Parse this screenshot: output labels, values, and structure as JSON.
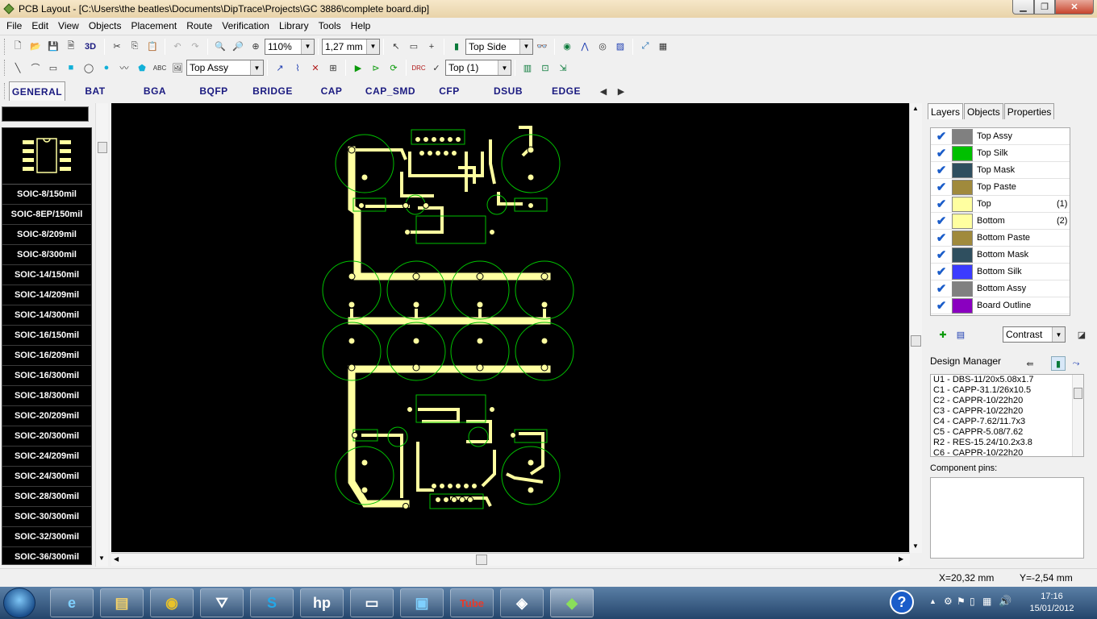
{
  "window": {
    "title": "PCB Layout - [C:\\Users\\the beatles\\Documents\\DipTrace\\Projects\\GC 3886\\complete board.dip]"
  },
  "menu": [
    "File",
    "Edit",
    "View",
    "Objects",
    "Placement",
    "Route",
    "Verification",
    "Library",
    "Tools",
    "Help"
  ],
  "toolbar": {
    "zoom_value": "110%",
    "grid_value": "1,27 mm",
    "side_value": "Top Side",
    "view_3d_label": "3D",
    "display_mode_value": "Top Assy",
    "layer_value": "Top (1)"
  },
  "library_tabs": [
    "GENERAL",
    "BAT",
    "BGA",
    "BQFP",
    "BRIDGE",
    "CAP",
    "CAP_SMD",
    "CFP",
    "DSUB",
    "EDGE"
  ],
  "library_items": [
    "SOIC-8/150mil",
    "SOIC-8EP/150mil",
    "SOIC-8/209mil",
    "SOIC-8/300mil",
    "SOIC-14/150mil",
    "SOIC-14/209mil",
    "SOIC-14/300mil",
    "SOIC-16/150mil",
    "SOIC-16/209mil",
    "SOIC-16/300mil",
    "SOIC-18/300mil",
    "SOIC-20/209mil",
    "SOIC-20/300mil",
    "SOIC-24/209mil",
    "SOIC-24/300mil",
    "SOIC-28/300mil",
    "SOIC-30/300mil",
    "SOIC-32/300mil",
    "SOIC-36/300mil"
  ],
  "right_tabs": [
    "Layers",
    "Objects",
    "Properties"
  ],
  "layers": [
    {
      "name": "Top Assy",
      "color": "#808080",
      "num": ""
    },
    {
      "name": "Top Silk",
      "color": "#00c000",
      "num": ""
    },
    {
      "name": "Top Mask",
      "color": "#2f4f5f",
      "num": ""
    },
    {
      "name": "Top Paste",
      "color": "#a08a3c",
      "num": ""
    },
    {
      "name": "Top",
      "color": "#ffffa0",
      "num": "(1)"
    },
    {
      "name": "Bottom",
      "color": "#ffffa0",
      "num": "(2)"
    },
    {
      "name": "Bottom Paste",
      "color": "#a08a3c",
      "num": ""
    },
    {
      "name": "Bottom Mask",
      "color": "#2f4f5f",
      "num": ""
    },
    {
      "name": "Bottom Silk",
      "color": "#3b3bff",
      "num": ""
    },
    {
      "name": "Bottom Assy",
      "color": "#808080",
      "num": ""
    },
    {
      "name": "Board Outline",
      "color": "#8a00c0",
      "num": ""
    }
  ],
  "contrast_value": "Contrast",
  "design_manager": {
    "title": "Design Manager",
    "items": [
      "U1 - DBS-11/20x5.08x1.7",
      "C1 - CAPP-31.1/26x10.5",
      "C2 - CAPPR-10/22h20",
      "C3 - CAPPR-10/22h20",
      "C4 - CAPP-7.62/11.7x3",
      "C5 - CAPPR-5.08/7.62",
      "R2 - RES-15.24/10.2x3.8",
      "C6 - CAPPR-10/22h20"
    ],
    "pins_title": "Component pins:"
  },
  "status": {
    "x": "X=20,32 mm",
    "y": "Y=-2,54 mm"
  },
  "clock": {
    "time": "17:16",
    "date": "15/01/2012"
  },
  "colors": {
    "trace": "#ffffa0",
    "silk": "#00c000",
    "canvas": "#000000"
  }
}
